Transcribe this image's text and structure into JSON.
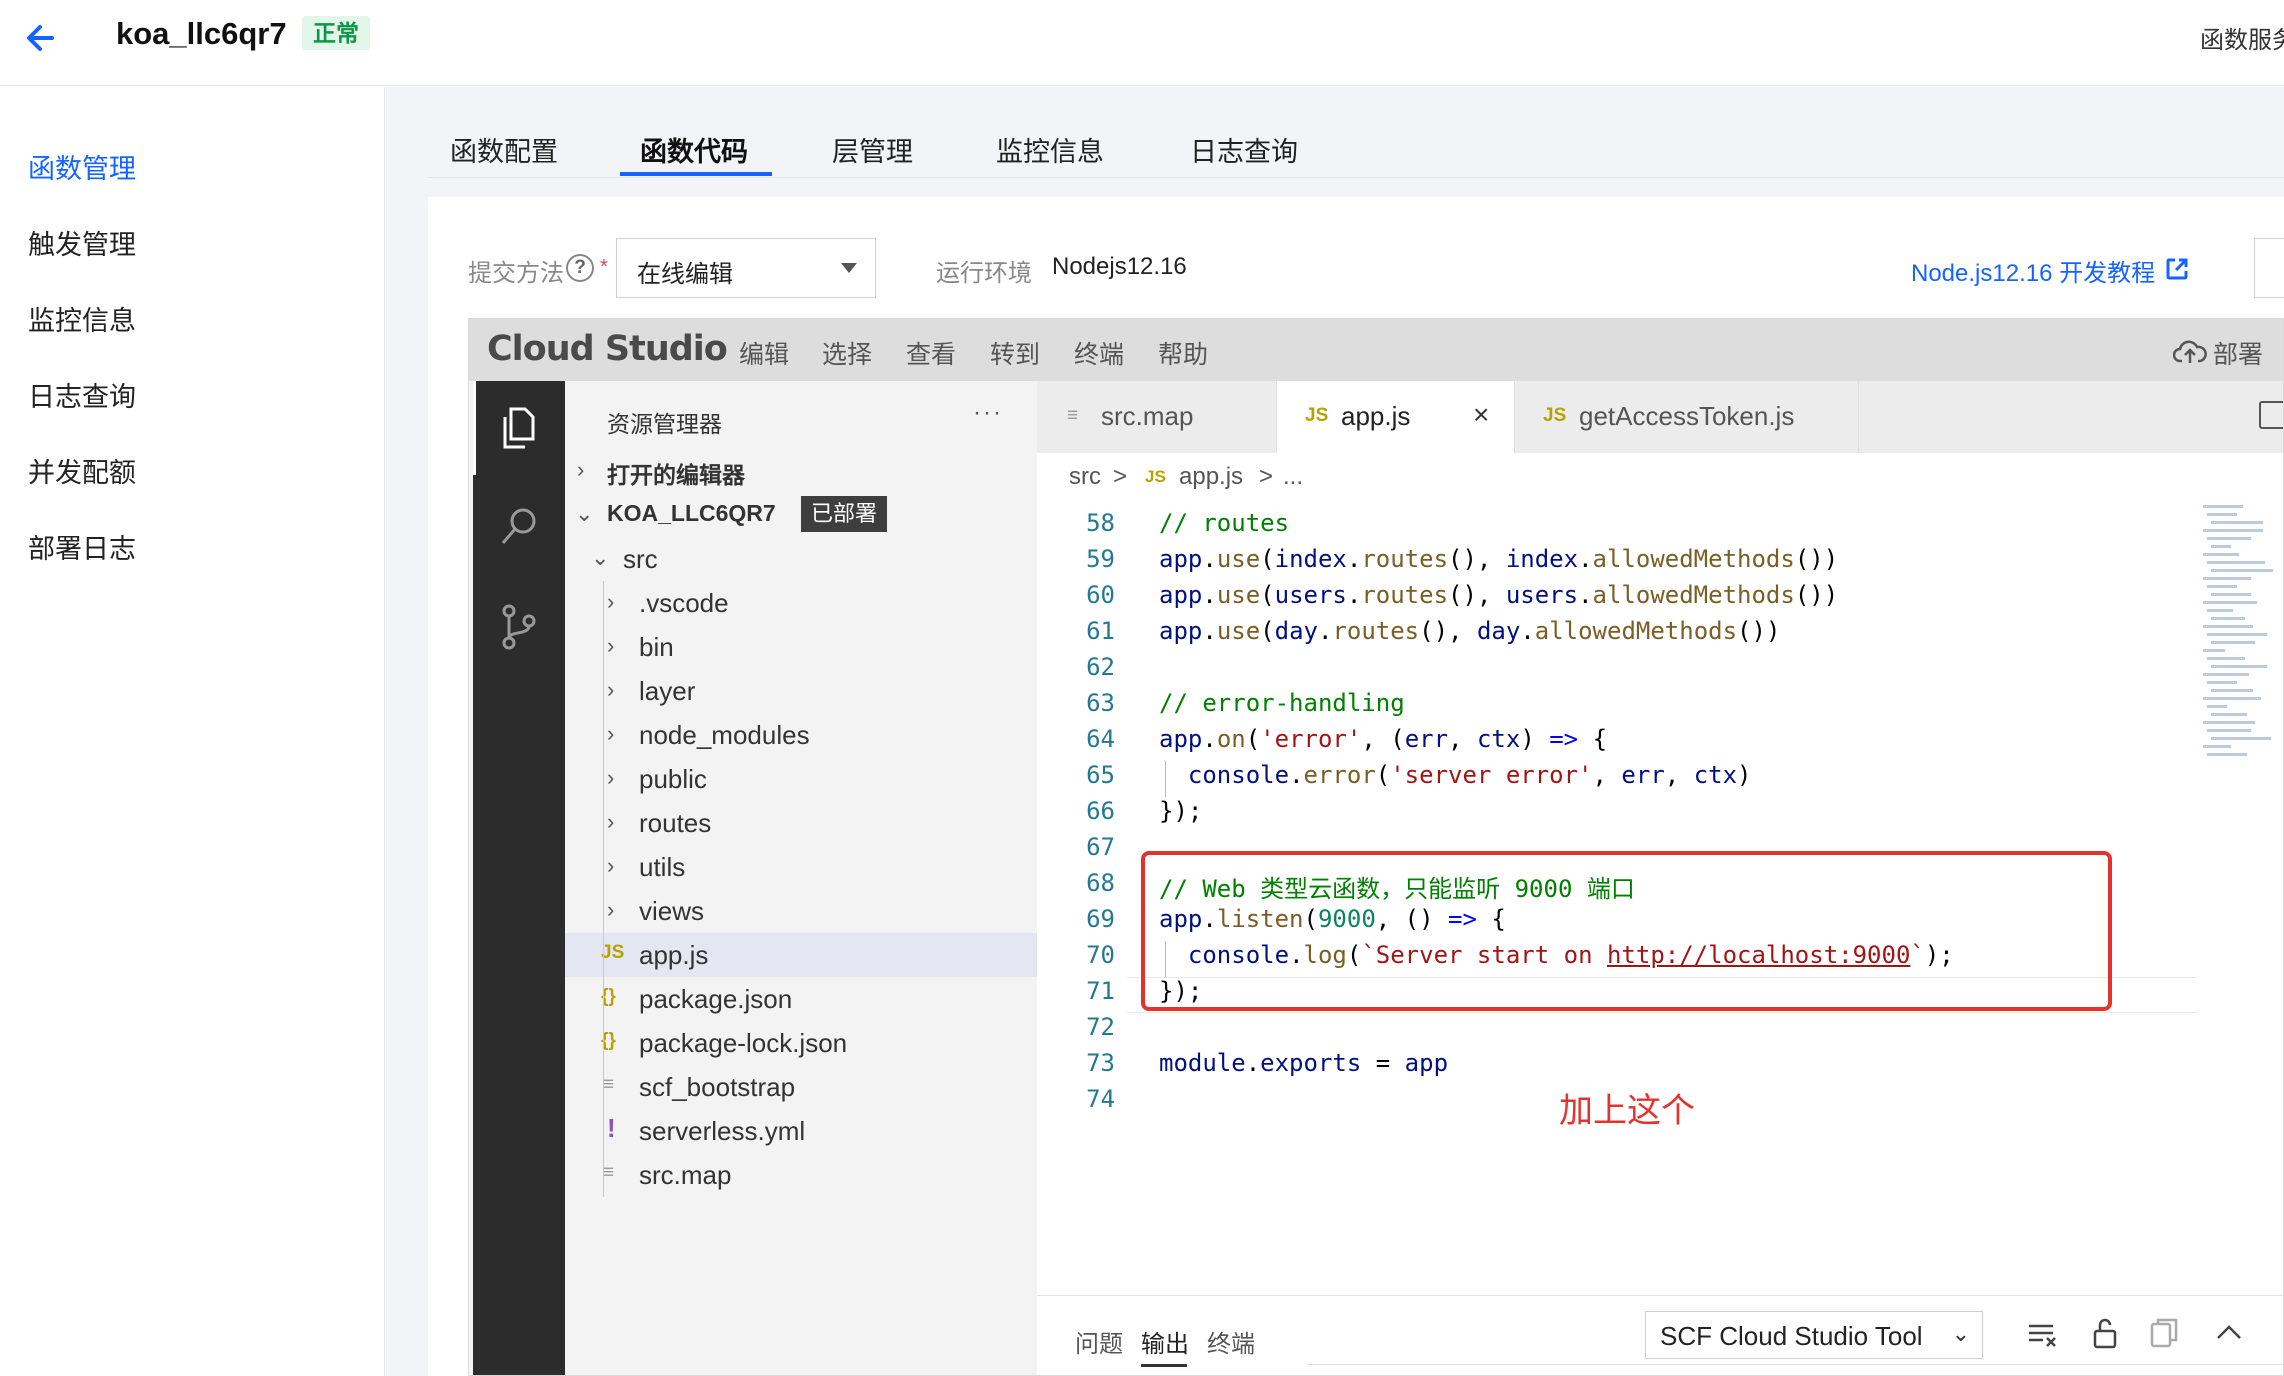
{
  "header": {
    "function_name": "koa_llc6qr7",
    "status": "正常",
    "right_text": "函数服务"
  },
  "sidebar": {
    "items": [
      {
        "label": "函数管理",
        "active": true
      },
      {
        "label": "触发管理",
        "active": false
      },
      {
        "label": "监控信息",
        "active": false
      },
      {
        "label": "日志查询",
        "active": false
      },
      {
        "label": "并发配额",
        "active": false
      },
      {
        "label": "部署日志",
        "active": false
      }
    ]
  },
  "tabs": [
    {
      "label": "函数配置"
    },
    {
      "label": "函数代码"
    },
    {
      "label": "层管理"
    },
    {
      "label": "监控信息"
    },
    {
      "label": "日志查询"
    }
  ],
  "form": {
    "submit_label": "提交方法",
    "help_icon": "?",
    "required_mark": "*",
    "submit_method": "在线编辑",
    "runtime_label": "运行环境",
    "runtime_value": "Nodejs12.16",
    "tutorial_link": "Node.js12.16 开发教程"
  },
  "ide": {
    "logo": "Cloud Studio",
    "menus": [
      "编辑",
      "选择",
      "查看",
      "转到",
      "终端",
      "帮助"
    ],
    "deploy_label": "部署",
    "explorer_title": "资源管理器",
    "explorer_more": "···",
    "open_editors": "打开的编辑器",
    "project": "KOA_LLC6QR7",
    "deployed_badge": "已部署",
    "tree": [
      {
        "name": "src",
        "type": "folder-open"
      },
      {
        "name": ".vscode",
        "type": "folder"
      },
      {
        "name": "bin",
        "type": "folder"
      },
      {
        "name": "layer",
        "type": "folder"
      },
      {
        "name": "node_modules",
        "type": "folder"
      },
      {
        "name": "public",
        "type": "folder"
      },
      {
        "name": "routes",
        "type": "folder"
      },
      {
        "name": "utils",
        "type": "folder"
      },
      {
        "name": "views",
        "type": "folder"
      },
      {
        "name": "app.js",
        "type": "js",
        "selected": true
      },
      {
        "name": "package.json",
        "type": "json"
      },
      {
        "name": "package-lock.json",
        "type": "json"
      },
      {
        "name": "scf_bootstrap",
        "type": "text"
      },
      {
        "name": "serverless.yml",
        "type": "yml"
      },
      {
        "name": "src.map",
        "type": "text"
      }
    ],
    "editor_tabs": [
      {
        "label": "src.map",
        "icon": "≡",
        "active": false
      },
      {
        "label": "app.js",
        "icon": "JS",
        "active": true,
        "close": "×"
      },
      {
        "label": "getAccessToken.js",
        "icon": "JS",
        "active": false
      }
    ],
    "breadcrumb": [
      "src",
      ">",
      "JS",
      "app.js",
      ">",
      "..."
    ],
    "code": [
      {
        "ln": "58",
        "text": "// routes"
      },
      {
        "ln": "59",
        "text": "app.use(index.routes(), index.allowedMethods())"
      },
      {
        "ln": "60",
        "text": "app.use(users.routes(), users.allowedMethods())"
      },
      {
        "ln": "61",
        "text": "app.use(day.routes(), day.allowedMethods())"
      },
      {
        "ln": "62",
        "text": ""
      },
      {
        "ln": "63",
        "text": "// error-handling"
      },
      {
        "ln": "64",
        "text": "app.on('error', (err, ctx) => {"
      },
      {
        "ln": "65",
        "text": "  console.error('server error', err, ctx)"
      },
      {
        "ln": "66",
        "text": "});"
      },
      {
        "ln": "67",
        "text": ""
      },
      {
        "ln": "68",
        "text": "// Web 类型云函数，只能监听 9000 端口"
      },
      {
        "ln": "69",
        "text": "app.listen(9000, () => {"
      },
      {
        "ln": "70",
        "text": "  console.log(`Server start on http://localhost:9000`);"
      },
      {
        "ln": "71",
        "text": "});"
      },
      {
        "ln": "72",
        "text": ""
      },
      {
        "ln": "73",
        "text": "module.exports = app"
      },
      {
        "ln": "74",
        "text": ""
      }
    ],
    "annotation": "加上这个",
    "bottom_tabs": [
      {
        "label": "问题",
        "active": false
      },
      {
        "label": "输出",
        "active": true
      },
      {
        "label": "终端",
        "active": false
      }
    ],
    "output_channel": "SCF Cloud Studio Tool"
  },
  "colors": {
    "accent": "#1664ff",
    "status_bg": "#e4f6ea",
    "status_text": "#0a9848",
    "annotation": "#e5322d"
  }
}
